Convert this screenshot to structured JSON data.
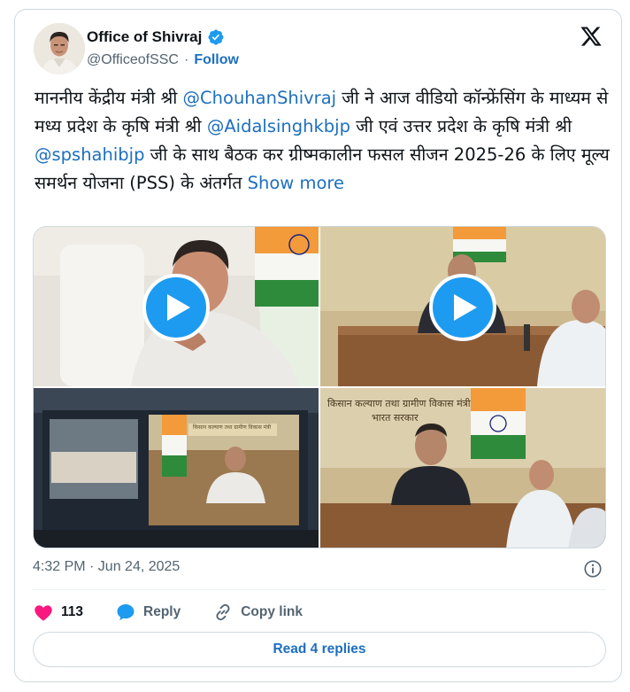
{
  "author": {
    "name": "Office of Shivraj",
    "handle": "@OfficeofSSC",
    "separator": "·",
    "follow_label": "Follow"
  },
  "tweet": {
    "text_parts": [
      {
        "t": "माननीय केंद्रीय मंत्री श्री ",
        "m": false
      },
      {
        "t": "@ChouhanShivraj",
        "m": true
      },
      {
        "t": " जी ने आज वीडियो कॉन्फ्रेंसिंग के माध्यम से मध्य प्रदेश के कृषि मंत्री श्री ",
        "m": false
      },
      {
        "t": "@Aidalsinghkbjp",
        "m": true
      },
      {
        "t": " जी एवं उत्तर प्रदेश के कृषि मंत्री श्री ",
        "m": false
      },
      {
        "t": "@spshahibjp",
        "m": true
      },
      {
        "t": " जी के साथ बैठक कर ग्रीष्मकालीन फसल सीजन 2025-26 के लिए मूल्य समर्थन योजना (PSS) के अंतर्गत ",
        "m": false
      }
    ],
    "show_more": "Show more",
    "timestamp": "4:32 PM · Jun 24, 2025"
  },
  "media": {
    "banner_1": "किसान कल्याण तथा ग्रामीण विकास मंत्री",
    "banner_1b": "भारत सरकार",
    "banner_2": "किसान कल्याण तथा ग्रामीण विकास मंत्री",
    "banner_2b": "भारत सरकार"
  },
  "actions": {
    "like_count": "113",
    "reply_label": "Reply",
    "copy_link_label": "Copy link"
  },
  "read_replies_label": "Read 4 replies",
  "colors": {
    "link": "#1d6fbf",
    "like": "#f91880",
    "play": "#1d9bf0",
    "muted": "#536471"
  }
}
